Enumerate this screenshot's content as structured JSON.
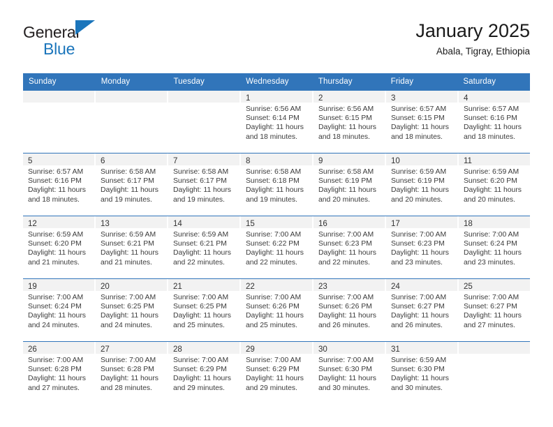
{
  "brand": {
    "name_top": "General",
    "name_bottom": "Blue",
    "accent_color": "#1b75bb"
  },
  "header": {
    "title": "January 2025",
    "subtitle": "Abala, Tigray, Ethiopia"
  },
  "calendar": {
    "header_color": "#3175ba",
    "weekdays": [
      "Sunday",
      "Monday",
      "Tuesday",
      "Wednesday",
      "Thursday",
      "Friday",
      "Saturday"
    ],
    "weeks": [
      [
        {
          "day": "",
          "sunrise": "",
          "sunset": "",
          "daylight": "",
          "empty": true
        },
        {
          "day": "",
          "sunrise": "",
          "sunset": "",
          "daylight": "",
          "empty": true
        },
        {
          "day": "",
          "sunrise": "",
          "sunset": "",
          "daylight": "",
          "empty": true
        },
        {
          "day": "1",
          "sunrise": "Sunrise: 6:56 AM",
          "sunset": "Sunset: 6:14 PM",
          "daylight": "Daylight: 11 hours and 18 minutes."
        },
        {
          "day": "2",
          "sunrise": "Sunrise: 6:56 AM",
          "sunset": "Sunset: 6:15 PM",
          "daylight": "Daylight: 11 hours and 18 minutes."
        },
        {
          "day": "3",
          "sunrise": "Sunrise: 6:57 AM",
          "sunset": "Sunset: 6:15 PM",
          "daylight": "Daylight: 11 hours and 18 minutes."
        },
        {
          "day": "4",
          "sunrise": "Sunrise: 6:57 AM",
          "sunset": "Sunset: 6:16 PM",
          "daylight": "Daylight: 11 hours and 18 minutes."
        }
      ],
      [
        {
          "day": "5",
          "sunrise": "Sunrise: 6:57 AM",
          "sunset": "Sunset: 6:16 PM",
          "daylight": "Daylight: 11 hours and 18 minutes."
        },
        {
          "day": "6",
          "sunrise": "Sunrise: 6:58 AM",
          "sunset": "Sunset: 6:17 PM",
          "daylight": "Daylight: 11 hours and 19 minutes."
        },
        {
          "day": "7",
          "sunrise": "Sunrise: 6:58 AM",
          "sunset": "Sunset: 6:17 PM",
          "daylight": "Daylight: 11 hours and 19 minutes."
        },
        {
          "day": "8",
          "sunrise": "Sunrise: 6:58 AM",
          "sunset": "Sunset: 6:18 PM",
          "daylight": "Daylight: 11 hours and 19 minutes."
        },
        {
          "day": "9",
          "sunrise": "Sunrise: 6:58 AM",
          "sunset": "Sunset: 6:19 PM",
          "daylight": "Daylight: 11 hours and 20 minutes."
        },
        {
          "day": "10",
          "sunrise": "Sunrise: 6:59 AM",
          "sunset": "Sunset: 6:19 PM",
          "daylight": "Daylight: 11 hours and 20 minutes."
        },
        {
          "day": "11",
          "sunrise": "Sunrise: 6:59 AM",
          "sunset": "Sunset: 6:20 PM",
          "daylight": "Daylight: 11 hours and 20 minutes."
        }
      ],
      [
        {
          "day": "12",
          "sunrise": "Sunrise: 6:59 AM",
          "sunset": "Sunset: 6:20 PM",
          "daylight": "Daylight: 11 hours and 21 minutes."
        },
        {
          "day": "13",
          "sunrise": "Sunrise: 6:59 AM",
          "sunset": "Sunset: 6:21 PM",
          "daylight": "Daylight: 11 hours and 21 minutes."
        },
        {
          "day": "14",
          "sunrise": "Sunrise: 6:59 AM",
          "sunset": "Sunset: 6:21 PM",
          "daylight": "Daylight: 11 hours and 22 minutes."
        },
        {
          "day": "15",
          "sunrise": "Sunrise: 7:00 AM",
          "sunset": "Sunset: 6:22 PM",
          "daylight": "Daylight: 11 hours and 22 minutes."
        },
        {
          "day": "16",
          "sunrise": "Sunrise: 7:00 AM",
          "sunset": "Sunset: 6:23 PM",
          "daylight": "Daylight: 11 hours and 22 minutes."
        },
        {
          "day": "17",
          "sunrise": "Sunrise: 7:00 AM",
          "sunset": "Sunset: 6:23 PM",
          "daylight": "Daylight: 11 hours and 23 minutes."
        },
        {
          "day": "18",
          "sunrise": "Sunrise: 7:00 AM",
          "sunset": "Sunset: 6:24 PM",
          "daylight": "Daylight: 11 hours and 23 minutes."
        }
      ],
      [
        {
          "day": "19",
          "sunrise": "Sunrise: 7:00 AM",
          "sunset": "Sunset: 6:24 PM",
          "daylight": "Daylight: 11 hours and 24 minutes."
        },
        {
          "day": "20",
          "sunrise": "Sunrise: 7:00 AM",
          "sunset": "Sunset: 6:25 PM",
          "daylight": "Daylight: 11 hours and 24 minutes."
        },
        {
          "day": "21",
          "sunrise": "Sunrise: 7:00 AM",
          "sunset": "Sunset: 6:25 PM",
          "daylight": "Daylight: 11 hours and 25 minutes."
        },
        {
          "day": "22",
          "sunrise": "Sunrise: 7:00 AM",
          "sunset": "Sunset: 6:26 PM",
          "daylight": "Daylight: 11 hours and 25 minutes."
        },
        {
          "day": "23",
          "sunrise": "Sunrise: 7:00 AM",
          "sunset": "Sunset: 6:26 PM",
          "daylight": "Daylight: 11 hours and 26 minutes."
        },
        {
          "day": "24",
          "sunrise": "Sunrise: 7:00 AM",
          "sunset": "Sunset: 6:27 PM",
          "daylight": "Daylight: 11 hours and 26 minutes."
        },
        {
          "day": "25",
          "sunrise": "Sunrise: 7:00 AM",
          "sunset": "Sunset: 6:27 PM",
          "daylight": "Daylight: 11 hours and 27 minutes."
        }
      ],
      [
        {
          "day": "26",
          "sunrise": "Sunrise: 7:00 AM",
          "sunset": "Sunset: 6:28 PM",
          "daylight": "Daylight: 11 hours and 27 minutes."
        },
        {
          "day": "27",
          "sunrise": "Sunrise: 7:00 AM",
          "sunset": "Sunset: 6:28 PM",
          "daylight": "Daylight: 11 hours and 28 minutes."
        },
        {
          "day": "28",
          "sunrise": "Sunrise: 7:00 AM",
          "sunset": "Sunset: 6:29 PM",
          "daylight": "Daylight: 11 hours and 29 minutes."
        },
        {
          "day": "29",
          "sunrise": "Sunrise: 7:00 AM",
          "sunset": "Sunset: 6:29 PM",
          "daylight": "Daylight: 11 hours and 29 minutes."
        },
        {
          "day": "30",
          "sunrise": "Sunrise: 7:00 AM",
          "sunset": "Sunset: 6:30 PM",
          "daylight": "Daylight: 11 hours and 30 minutes."
        },
        {
          "day": "31",
          "sunrise": "Sunrise: 6:59 AM",
          "sunset": "Sunset: 6:30 PM",
          "daylight": "Daylight: 11 hours and 30 minutes."
        },
        {
          "day": "",
          "sunrise": "",
          "sunset": "",
          "daylight": "",
          "empty": true
        }
      ]
    ]
  }
}
